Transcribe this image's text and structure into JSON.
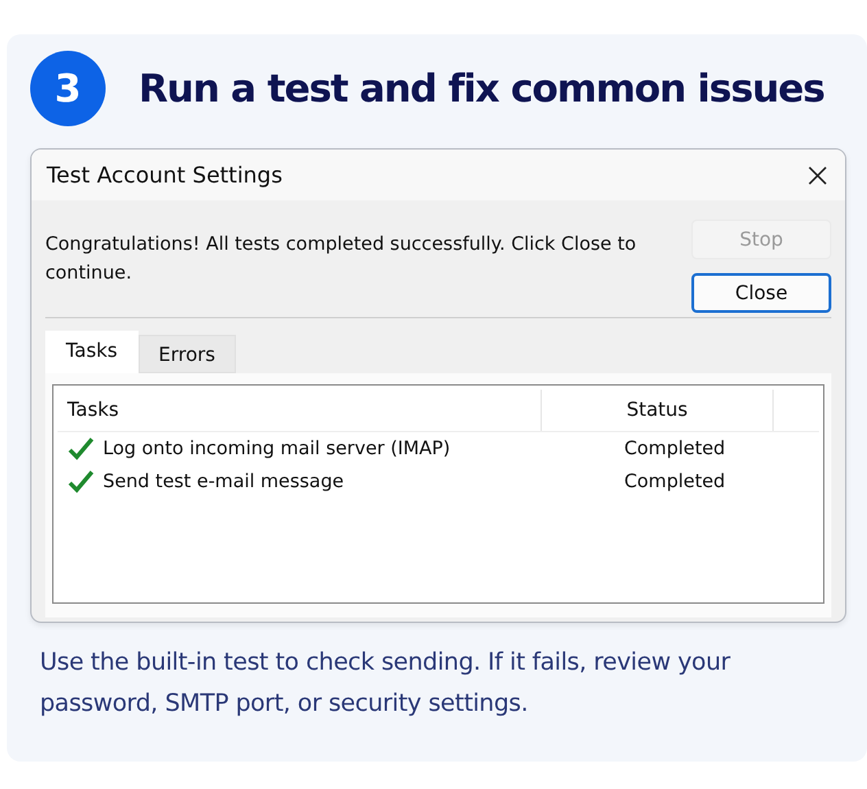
{
  "step": {
    "number": "3",
    "title": "Run a test and fix common issues"
  },
  "dialog": {
    "title": "Test Account Settings",
    "message": "Congratulations! All tests completed successfully. Click Close to continue.",
    "buttons": [
      {
        "label": "Stop",
        "disabled": true,
        "default": false
      },
      {
        "label": "Close",
        "disabled": false,
        "default": true
      }
    ],
    "tabs": [
      {
        "label": "Tasks",
        "selected": true
      },
      {
        "label": "Errors",
        "selected": false
      }
    ],
    "table": {
      "columns": [
        "Tasks",
        "Status"
      ],
      "rows": [
        {
          "task": "Log onto incoming mail server (IMAP)",
          "status": "Completed"
        },
        {
          "task": "Send test e-mail message",
          "status": "Completed"
        }
      ]
    }
  },
  "caption": "Use the built-in test to check sending. If it fails, review your password, SMTP port, or security settings."
}
